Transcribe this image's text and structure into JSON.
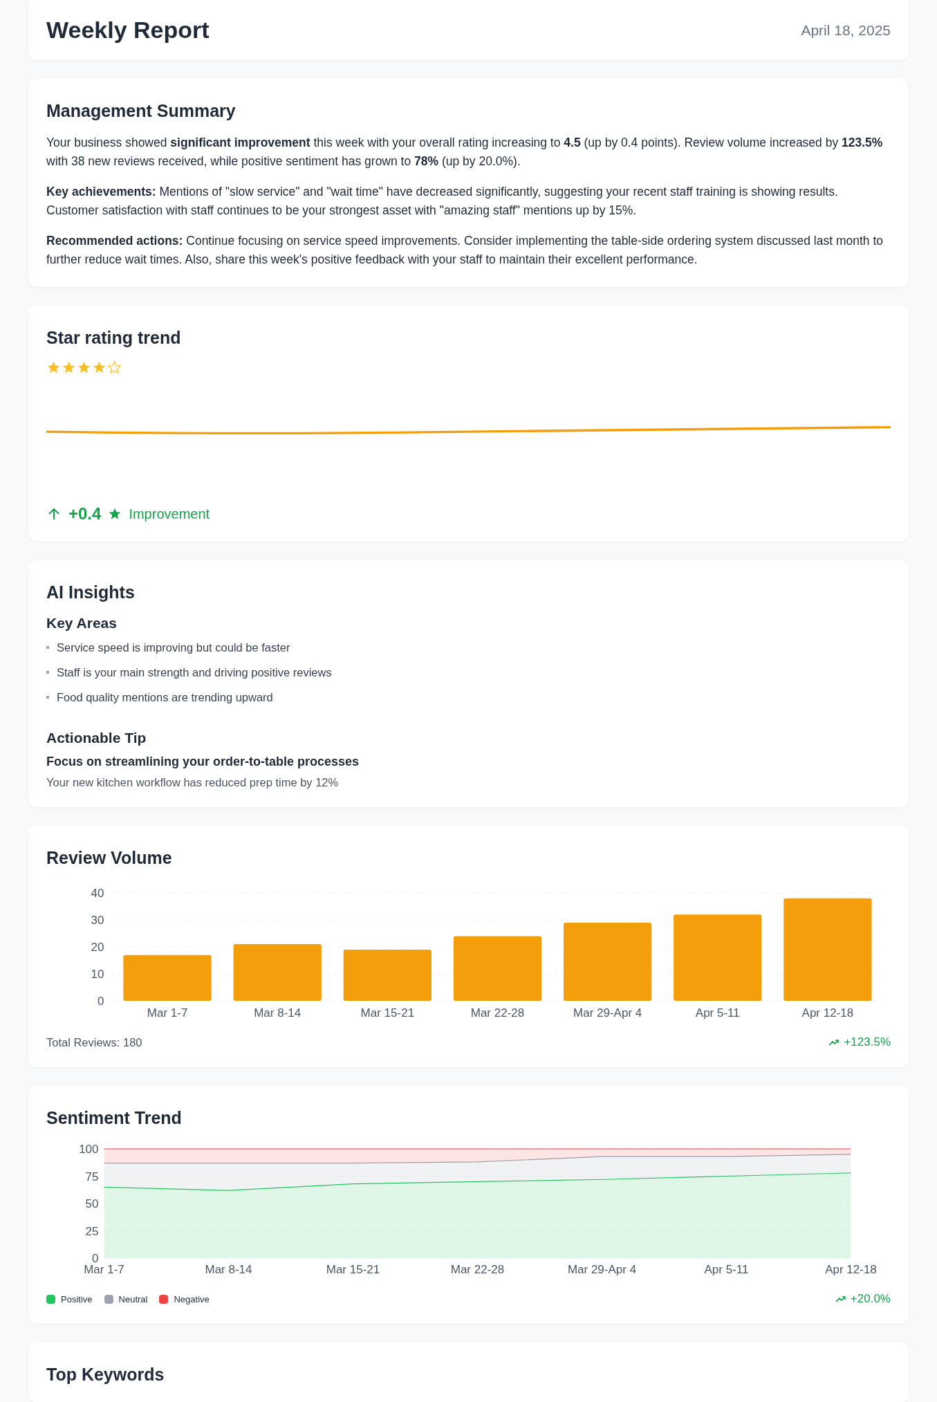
{
  "header": {
    "title": "Weekly Report",
    "date": "April 18, 2025"
  },
  "summary": {
    "title": "Management Summary",
    "paragraphs": [
      "Your business showed **significant improvement** this week with your overall rating increasing to **4.5** (up by 0.4 points). Review volume increased by **123.5%** with 38 new reviews received, while positive sentiment has grown to **78%** (up by 20.0%).",
      "**Key achievements:** Mentions of \"slow service\" and \"wait time\" have decreased significantly, suggesting your recent staff training is showing results. Customer satisfaction with staff continues to be your strongest asset with \"amazing staff\" mentions up by 15%.",
      "**Recommended actions:** Continue focusing on service speed improvements. Consider implementing the table-side ordering system discussed last month to further reduce wait times. Also, share this week's positive feedback with your staff to maintain their excellent performance."
    ]
  },
  "star_trend": {
    "title": "Star rating trend",
    "stars": 4,
    "change": "+0.4",
    "change_label": "Improvement"
  },
  "ai_insights": {
    "title": "AI Insights",
    "key_areas_title": "Key Areas",
    "key_areas": [
      "Service speed is improving but could be faster",
      "Staff is your main strength and driving positive reviews",
      "Food quality mentions are trending upward"
    ],
    "tip_title": "Actionable Tip",
    "tip_heading": "Focus on streamlining your order-to-table processes",
    "tip_text": "Your new kitchen workflow has reduced prep time by 12%"
  },
  "review_volume": {
    "title": "Review Volume",
    "chart_data": {
      "type": "bar",
      "categories": [
        "Mar 1-7",
        "Mar 8-14",
        "Mar 15-21",
        "Mar 22-28",
        "Mar 29-Apr 4",
        "Apr 5-11",
        "Apr 12-18"
      ],
      "values": [
        17,
        21,
        19,
        24,
        29,
        32,
        38
      ],
      "ylim": [
        0,
        40
      ],
      "yticks": [
        0,
        10,
        20,
        30,
        40
      ],
      "grid": true
    },
    "total": "Total Reviews: 180",
    "change": "+123.5%"
  },
  "sentiment": {
    "title": "Sentiment Trend",
    "chart_data": {
      "type": "area",
      "stacked": true,
      "x": [
        "Mar 1-7",
        "Mar 8-14",
        "Mar 15-21",
        "Mar 22-28",
        "Mar 29-Apr 4",
        "Apr 5-11",
        "Apr 12-18"
      ],
      "series": [
        {
          "name": "Positive",
          "color": "#22c55e",
          "values": [
            65,
            62,
            68,
            70,
            72,
            75,
            78
          ]
        },
        {
          "name": "Neutral",
          "color": "#9ca3af",
          "values": [
            22,
            25,
            19,
            18,
            21,
            18,
            17
          ]
        },
        {
          "name": "Negative",
          "color": "#ef4444",
          "values": [
            13,
            13,
            13,
            12,
            7,
            7,
            5
          ]
        }
      ],
      "ylim": [
        0,
        100
      ],
      "yticks": [
        0,
        25,
        50,
        75,
        100
      ],
      "grid": true
    },
    "change": "+20.0%"
  },
  "top_keywords": {
    "title": "Top Keywords"
  }
}
